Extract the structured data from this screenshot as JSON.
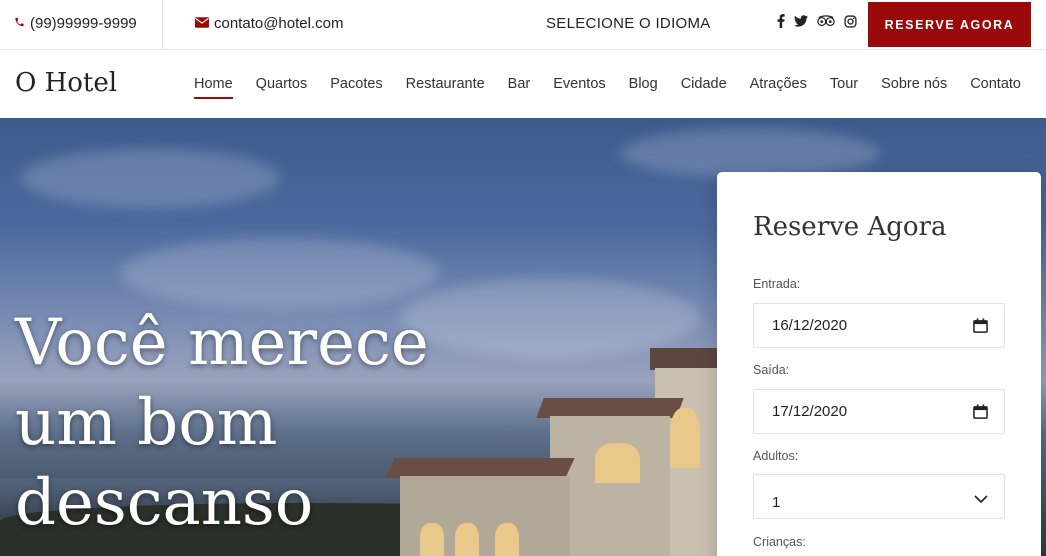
{
  "topbar": {
    "phone": "(99)99999-9999",
    "email": "contato@hotel.com",
    "language": "SELECIONE O IDIOMA",
    "social_icons": [
      "facebook-icon",
      "twitter-icon",
      "tripadvisor-icon",
      "instagram-icon"
    ],
    "reserve_button": "RESERVE AGORA"
  },
  "header": {
    "logo": "O Hotel",
    "nav": [
      {
        "label": "Home",
        "active": true
      },
      {
        "label": "Quartos"
      },
      {
        "label": "Pacotes"
      },
      {
        "label": "Restaurante"
      },
      {
        "label": "Bar"
      },
      {
        "label": "Eventos"
      },
      {
        "label": "Blog"
      },
      {
        "label": "Cidade"
      },
      {
        "label": "Atrações"
      },
      {
        "label": "Tour"
      },
      {
        "label": "Sobre nós"
      },
      {
        "label": "Contato"
      }
    ]
  },
  "hero": {
    "title_lines": [
      "Você merece",
      "um bom",
      "descanso"
    ]
  },
  "booking": {
    "title": "Reserve Agora",
    "checkin_label": "Entrada:",
    "checkin_value": "16/12/2020",
    "checkout_label": "Saída:",
    "checkout_value": "17/12/2020",
    "adults_label": "Adultos:",
    "adults_value": "1",
    "children_label": "Crianças:"
  },
  "colors": {
    "accent": "#9b0a0a"
  }
}
